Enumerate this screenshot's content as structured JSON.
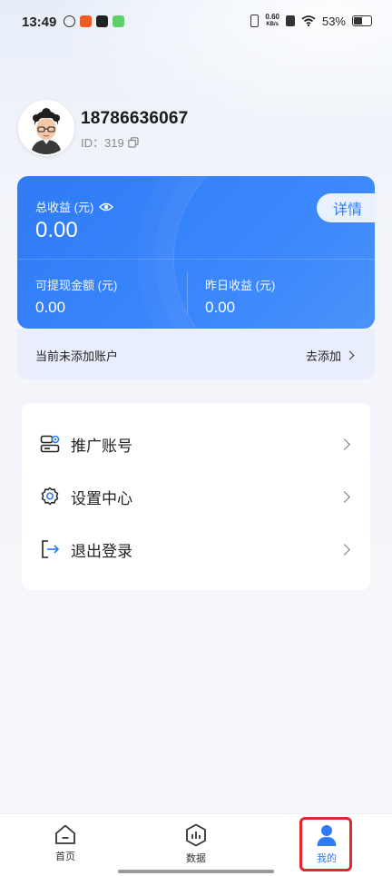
{
  "status_bar": {
    "time": "13:49",
    "net_speed_value": "0.60",
    "net_speed_unit": "KB/s",
    "battery": "53%"
  },
  "profile": {
    "phone": "18786636067",
    "id_label": "ID：319"
  },
  "earnings": {
    "total_label": "总收益 (元)",
    "total_value": "0.00",
    "detail_button": "详情",
    "withdrawable_label": "可提现金额 (元)",
    "withdrawable_value": "0.00",
    "yesterday_label": "昨日收益 (元)",
    "yesterday_value": "0.00"
  },
  "account": {
    "status_text": "当前未添加账户",
    "add_label": "去添加"
  },
  "menu": {
    "items": [
      {
        "label": "推广账号",
        "icon": "account-card-icon"
      },
      {
        "label": "设置中心",
        "icon": "gear-icon"
      },
      {
        "label": "退出登录",
        "icon": "logout-icon"
      }
    ]
  },
  "bottom_nav": {
    "items": [
      {
        "label": "首页",
        "icon": "home-icon"
      },
      {
        "label": "数据",
        "icon": "data-icon"
      },
      {
        "label": "我的",
        "icon": "person-icon"
      }
    ],
    "active_index": 2
  },
  "colors": {
    "accent": "#2f7bf5",
    "highlight": "#e0262f"
  }
}
